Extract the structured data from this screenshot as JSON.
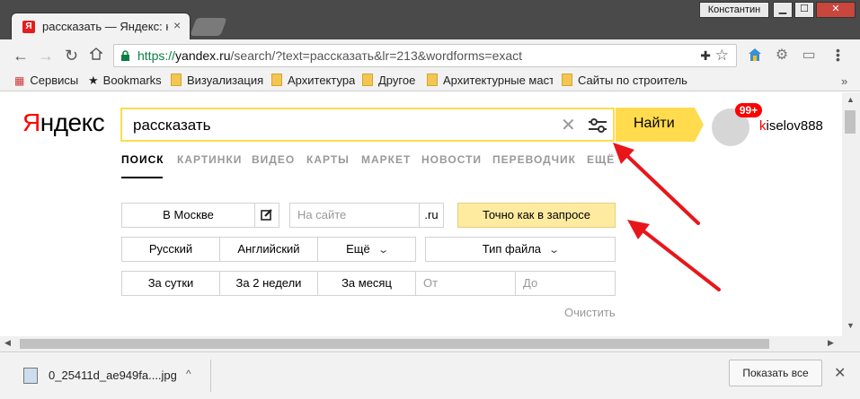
{
  "window": {
    "user": "Константин",
    "min_glyph": "▁",
    "max_glyph": "☐",
    "close_glyph": "✕"
  },
  "tab": {
    "favicon_letter": "Я",
    "title": "рассказать — Яндекс: на",
    "close_glyph": "×"
  },
  "toolbar": {
    "back_glyph": "←",
    "forward_glyph": "→",
    "reload_glyph": "↻",
    "url_scheme": "https://",
    "url_host": "yandex.ru",
    "url_path": "/search/?text=рассказать&lr=213&wordforms=exact"
  },
  "bookmarks": {
    "apps": "Сервисы",
    "bookmarks": "Bookmarks",
    "items": [
      "Визуализация",
      "Архитектура",
      "Другое",
      "Архитектурные масте",
      "Сайты по строитель"
    ],
    "more": "»"
  },
  "yandex": {
    "logo_first": "Я",
    "logo_rest": "ндекс",
    "query": "рассказать",
    "clear_glyph": "✕",
    "find_label": "Найти",
    "badge": "99+",
    "user_first": "k",
    "user_rest": "iselov888",
    "nav": [
      "ПОИСК",
      "КАРТИНКИ",
      "ВИДЕО",
      "КАРТЫ",
      "МАРКЕТ",
      "НОВОСТИ",
      "ПЕРЕВОДЧИК",
      "ЕЩЁ"
    ]
  },
  "advanced": {
    "region": "В Москве",
    "site_placeholder": "На сайте",
    "domain": ".ru",
    "exact": "Точно как в запросе",
    "lang_ru": "Русский",
    "lang_en": "Английский",
    "lang_more": "Ещё",
    "file_type": "Тип файла",
    "day": "За сутки",
    "two_weeks": "За 2 недели",
    "month": "За месяц",
    "from_placeholder": "От",
    "to_placeholder": "До",
    "clear": "Очистить"
  },
  "downloads": {
    "filename": "0_25411d_ae949fa....jpg",
    "caret": "^",
    "show_all": "Показать все",
    "close_glyph": "✕"
  },
  "colors": {
    "brand_yellow": "#ffdb4d",
    "exact_yellow": "#ffeba0",
    "arrow_red": "#e8161b"
  }
}
